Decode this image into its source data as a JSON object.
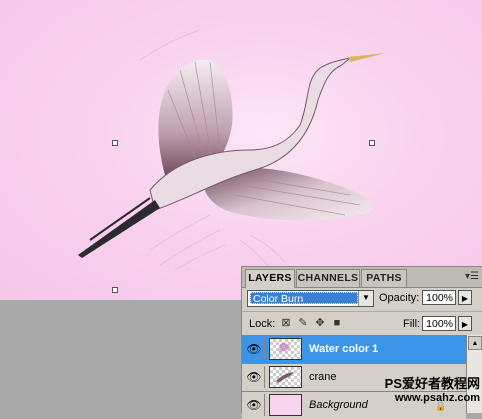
{
  "colors": {
    "canvas_bg": "#f8d0ec",
    "workspace_bg": "#a9a9a9",
    "panel_bg": "#d4d0c8",
    "selection_blue": "#3b94e8"
  },
  "layers_panel": {
    "tabs": [
      {
        "label": "LAYERS",
        "active": true
      },
      {
        "label": "CHANNELS",
        "active": false
      },
      {
        "label": "PATHS",
        "active": false
      }
    ],
    "menu_icon": "panel-menu-icon",
    "blend_mode": "Color Burn",
    "opacity_label": "Opacity:",
    "opacity_value": "100%",
    "lock_label": "Lock:",
    "fill_label": "Fill:",
    "fill_value": "100%",
    "layers": [
      {
        "name": "Water color 1",
        "selected": true,
        "visible": true
      },
      {
        "name": "crane",
        "selected": false,
        "visible": true
      },
      {
        "name": "Background",
        "selected": false,
        "visible": true,
        "locked": true
      }
    ]
  },
  "watermark": {
    "line1": "PS爱好者教程网",
    "line2": "www.psahz.com"
  }
}
